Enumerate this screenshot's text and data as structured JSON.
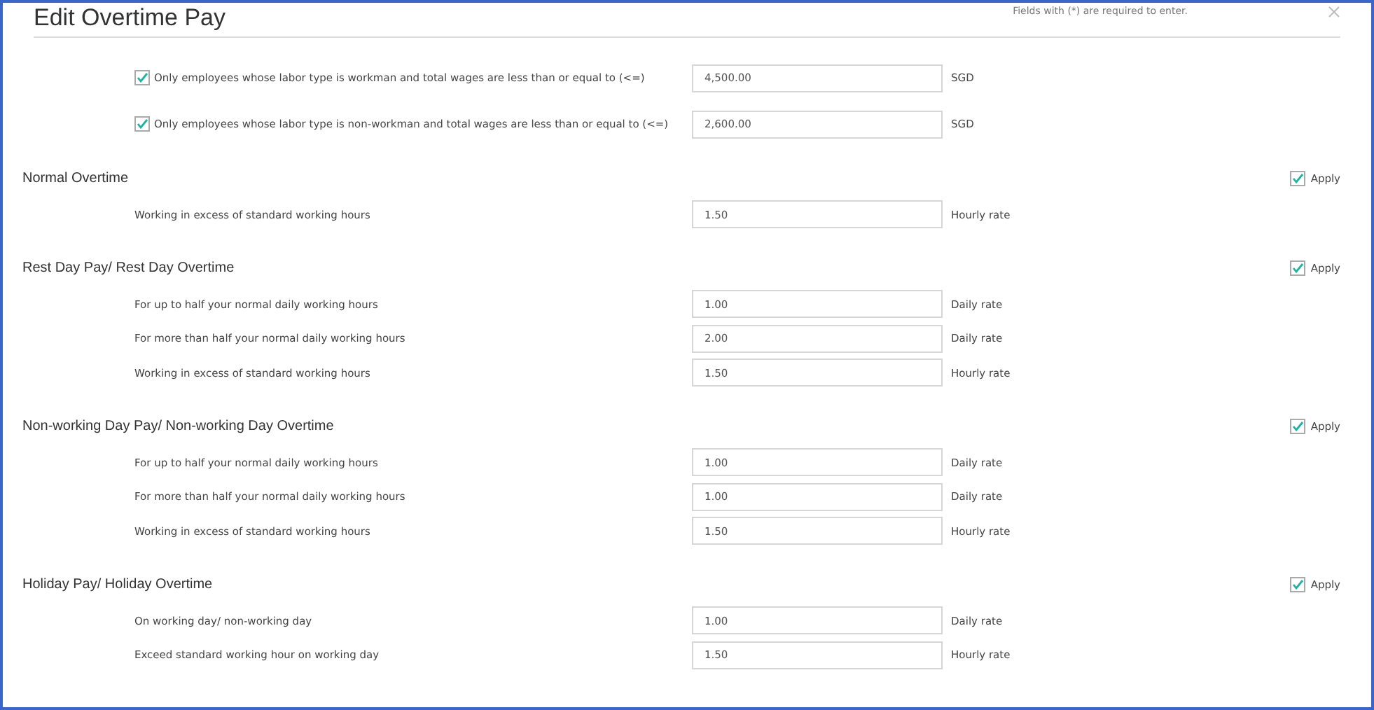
{
  "dialog": {
    "title": "Edit Overtime Pay",
    "required_note": "Fields with (*) are required to enter.",
    "eligibility": [
      {
        "label": "Only employees whose labor type is workman and total wages are less than or equal to (<=)",
        "checked": true,
        "value": "4,500.00",
        "unit": "SGD"
      },
      {
        "label": "Only employees whose labor type is non-workman and total wages are less than or equal to (<=)",
        "checked": true,
        "value": "2,600.00",
        "unit": "SGD"
      }
    ],
    "sections": [
      {
        "title": "Normal Overtime",
        "apply": {
          "label": "Apply",
          "checked": true
        },
        "rows": [
          {
            "label": "Working in excess of standard working hours",
            "value": "1.50",
            "unit": "Hourly rate"
          }
        ]
      },
      {
        "title": "Rest Day Pay/ Rest Day Overtime",
        "apply": {
          "label": "Apply",
          "checked": true
        },
        "rows": [
          {
            "label": "For up to half your normal daily working hours",
            "value": "1.00",
            "unit": "Daily rate"
          },
          {
            "label": "For more than half your normal daily working hours",
            "value": "2.00",
            "unit": "Daily rate"
          },
          {
            "label": "Working in excess of standard working hours",
            "value": "1.50",
            "unit": "Hourly rate"
          }
        ]
      },
      {
        "title": "Non-working Day Pay/ Non-working Day Overtime",
        "apply": {
          "label": "Apply",
          "checked": true
        },
        "rows": [
          {
            "label": "For up to half your normal daily working hours",
            "value": "1.00",
            "unit": "Daily rate"
          },
          {
            "label": "For more than half your normal daily working hours",
            "value": "1.00",
            "unit": "Daily rate"
          },
          {
            "label": "Working in excess of standard working hours",
            "value": "1.50",
            "unit": "Hourly rate"
          }
        ]
      },
      {
        "title": "Holiday Pay/ Holiday Overtime",
        "apply": {
          "label": "Apply",
          "checked": true
        },
        "rows": [
          {
            "label": "On working day/ non-working day",
            "value": "1.00",
            "unit": "Daily rate"
          },
          {
            "label": "Exceed standard working hour on working day",
            "value": "1.50",
            "unit": "Hourly rate"
          }
        ]
      }
    ]
  }
}
